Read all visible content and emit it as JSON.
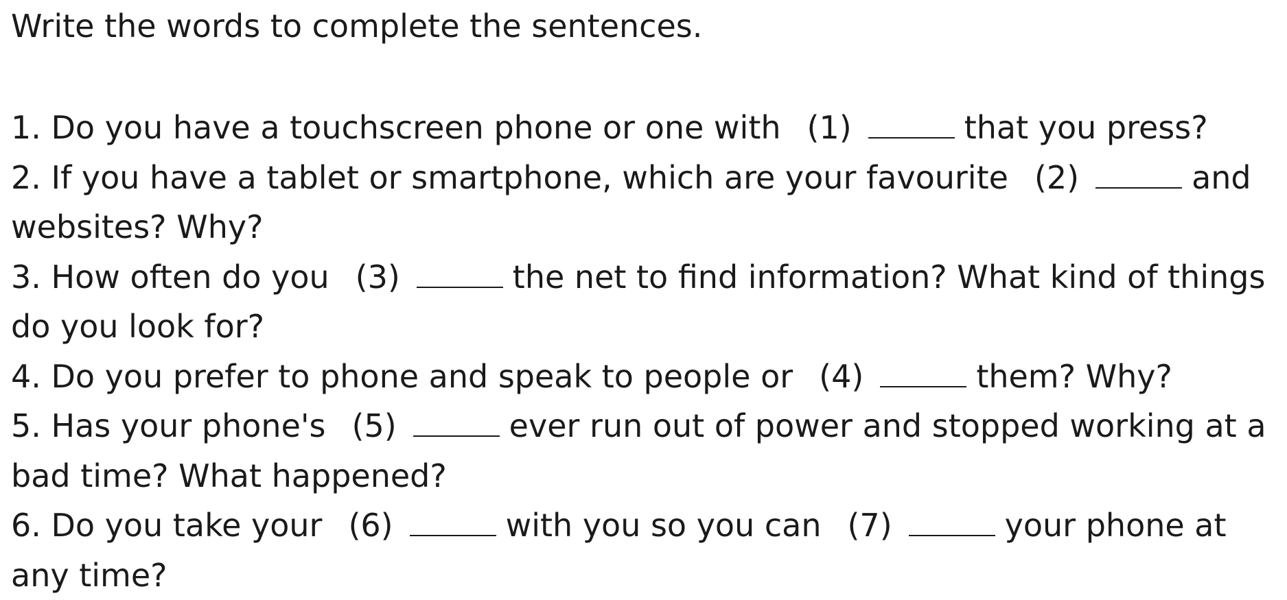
{
  "instruction": "Write the words to complete the sentences.",
  "questions": [
    {
      "number": "1.",
      "part1": "Do you have a touchscreen phone or one with",
      "ref1": "(1)",
      "part2": "that you press?"
    },
    {
      "number": "2.",
      "part1": "If you have a tablet or smartphone, which are your favourite",
      "ref1": "(2)",
      "part2": "and websites? Why?"
    },
    {
      "number": "3.",
      "part1": "How often do you",
      "ref1": "(3)",
      "part2": "the net to find information? What kind of things do you look for?"
    },
    {
      "number": "4.",
      "part1": "Do you prefer to phone and speak to people or",
      "ref1": "(4)",
      "part2": "them? Why?"
    },
    {
      "number": "5.",
      "part1": "Has your phone's",
      "ref1": "(5)",
      "part2": "ever run out of power and stopped working at a bad time? What happened?"
    },
    {
      "number": "6.",
      "part1": "Do you take your",
      "ref1": "(6)",
      "part2": "with you so you can",
      "ref2": "(7)",
      "part3": "your phone at any time?"
    }
  ]
}
